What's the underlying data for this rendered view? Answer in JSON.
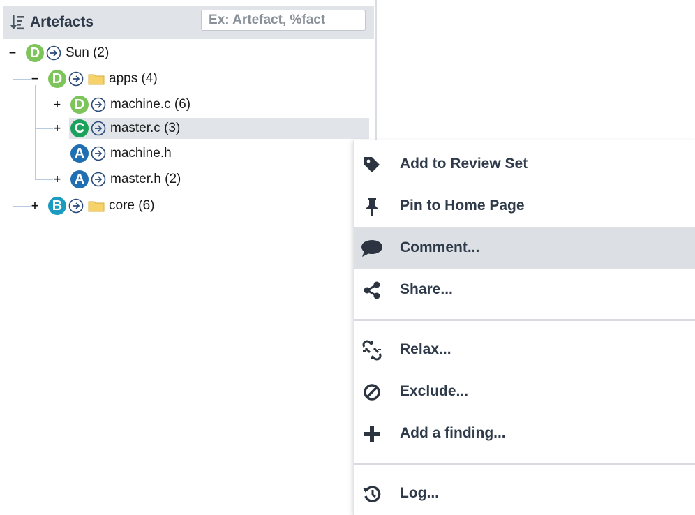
{
  "panel": {
    "title": "Artefacts",
    "sort_icon": "sort-descending-icon",
    "filter_placeholder": "Ex: Artefact, %fact"
  },
  "tree": {
    "nodes": [
      {
        "badge": "D",
        "badge_color": "#7dc45a",
        "label": "Sun (2)",
        "toggle": "−",
        "has_folder": false
      },
      {
        "badge": "D",
        "badge_color": "#7dc45a",
        "label": "apps (4)",
        "toggle": "−",
        "has_folder": true
      },
      {
        "badge": "D",
        "badge_color": "#7dc45a",
        "label": "machine.c (6)",
        "toggle": "+",
        "has_folder": false
      },
      {
        "badge": "C",
        "badge_color": "#1aa15b",
        "label": "master.c (3)",
        "toggle": "+",
        "has_folder": false,
        "selected": true
      },
      {
        "badge": "A",
        "badge_color": "#1f6fb2",
        "label": "machine.h",
        "toggle": "",
        "has_folder": false
      },
      {
        "badge": "A",
        "badge_color": "#1f6fb2",
        "label": "master.h (2)",
        "toggle": "+",
        "has_folder": false
      },
      {
        "badge": "B",
        "badge_color": "#1a9bbf",
        "label": "core (6)",
        "toggle": "+",
        "has_folder": true
      }
    ]
  },
  "context_menu": {
    "items": [
      {
        "label": "Add to Review Set",
        "icon": "tag-icon"
      },
      {
        "label": "Pin to Home Page",
        "icon": "pin-icon"
      },
      {
        "label": "Comment...",
        "icon": "comment-icon",
        "hover": true
      },
      {
        "label": "Share...",
        "icon": "share-icon"
      },
      {
        "label": "Relax...",
        "icon": "broken-link-icon"
      },
      {
        "label": "Exclude...",
        "icon": "prohibit-icon"
      },
      {
        "label": "Add a finding...",
        "icon": "plus-icon"
      },
      {
        "label": "Log...",
        "icon": "history-icon"
      }
    ]
  },
  "colors": {
    "header_bg": "#e0e3e7",
    "selected_row_bg": "#e1e4e8",
    "menu_hover_bg": "#dcdfe3",
    "menu_text": "#2f3b4a"
  }
}
